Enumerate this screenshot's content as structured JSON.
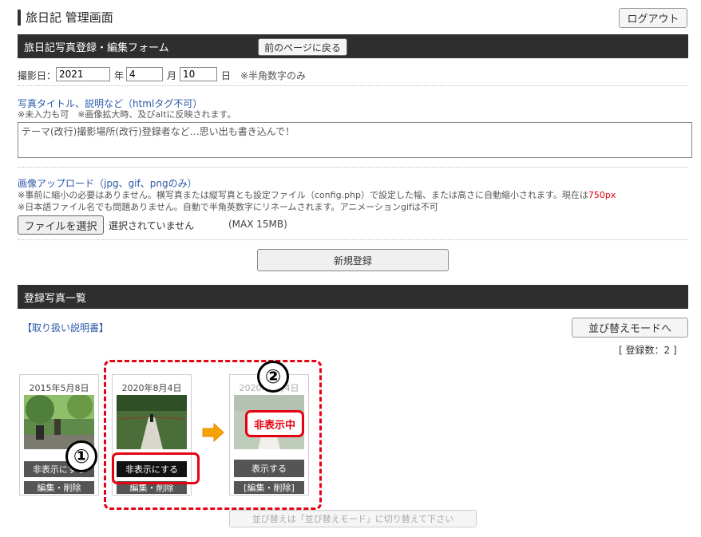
{
  "header": {
    "title": "旅日記 管理画面",
    "logout": "ログアウト"
  },
  "form": {
    "section_title": "旅日記写真登録・編集フォーム",
    "back_button": "前のページに戻る",
    "date_label": "撮影日：",
    "year": "2021",
    "year_unit": "年",
    "month": "4",
    "month_unit": "月",
    "day": "10",
    "day_unit": "日",
    "date_note": "※半角数字のみ",
    "title_label": "写真タイトル、説明など（htmlタグ不可）",
    "title_note": "※未入力も可　※画像拡大時、及びaltに反映されます。",
    "title_placeholder": "テーマ(改行)撮影場所(改行)登録者など…思い出も書き込んで！",
    "upload_label": "画像アップロード（jpg、gif、pngのみ）",
    "upload_note1": "※事前に縮小の必要はありません。横写真または縦写真とも設定ファイル（config.php）で設定した幅、または高さに自動縮小されます。現在は",
    "upload_note1_value": "750px",
    "upload_note2": "※日本語ファイル名でも問題ありません。自動で半角英数字にリネームされます。アニメーションgifは不可",
    "file_button": "ファイルを選択",
    "file_status": "選択されていません",
    "max_size": "(MAX 15MB)",
    "submit": "新規登録"
  },
  "list": {
    "section_title": "登録写真一覧",
    "manual_link": "【取り扱い説明書】",
    "sort_button": "並び替えモードへ",
    "count": "[ 登録数：2 ]",
    "sort_note": "並び替えは「並び替えモード」に切り替えて下さい",
    "cards": [
      {
        "date": "2015年5月8日",
        "toggle": "非表示にする",
        "edit": "編集・削除"
      },
      {
        "date": "2020年8月4日",
        "toggle": "非表示にする",
        "edit": "編集・削除"
      },
      {
        "date": "2020年8月4日",
        "hidden_badge": "非表示中",
        "toggle": "表示する",
        "edit": "[編集・削除]"
      }
    ]
  },
  "annotations": {
    "marker1": "①",
    "marker2": "②"
  },
  "colors": {
    "accent_red": "#e60012",
    "header_bar": "#2e2e2e",
    "link_blue": "#2b5aa8",
    "arrow": "#f5a200"
  }
}
